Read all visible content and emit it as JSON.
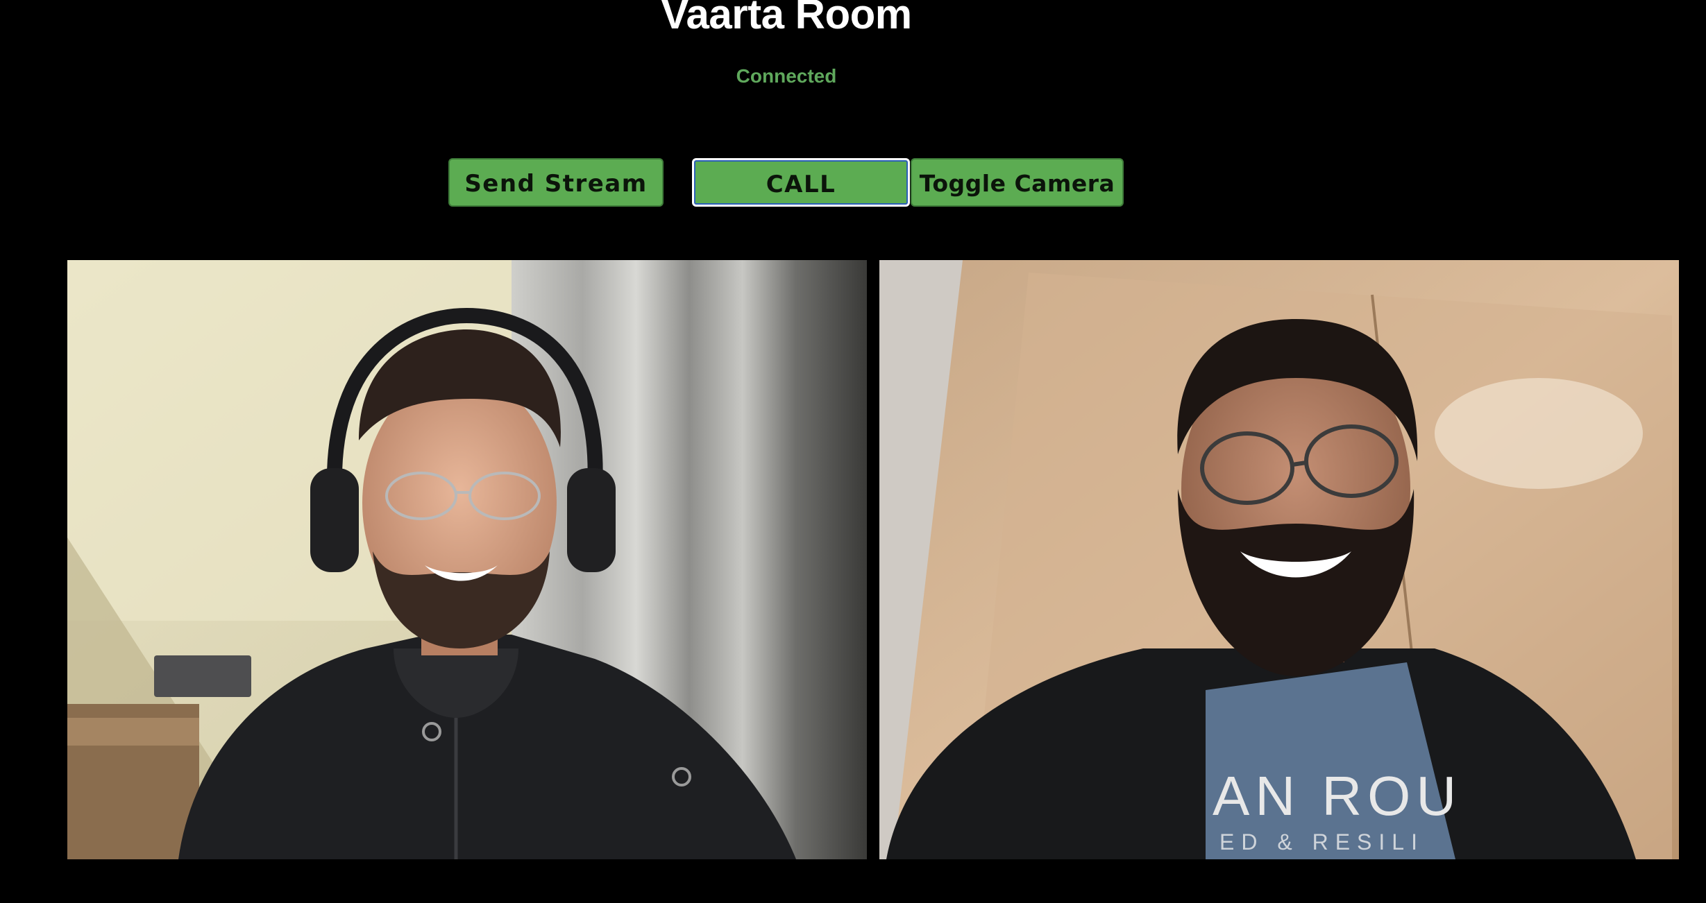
{
  "header": {
    "title": "Vaarta Room",
    "status": "Connected"
  },
  "controls": {
    "send_stream_label": "Send Stream",
    "call_label": "CALL",
    "toggle_camera_label": "Toggle Camera"
  },
  "colors": {
    "background": "#000000",
    "button": "#5cac52",
    "status_text": "#5fa85c",
    "title_text": "#ffffff"
  },
  "remote_video": {
    "shirt_text_line1": "AN ROU",
    "shirt_text_line2": "ED & RESILI"
  }
}
